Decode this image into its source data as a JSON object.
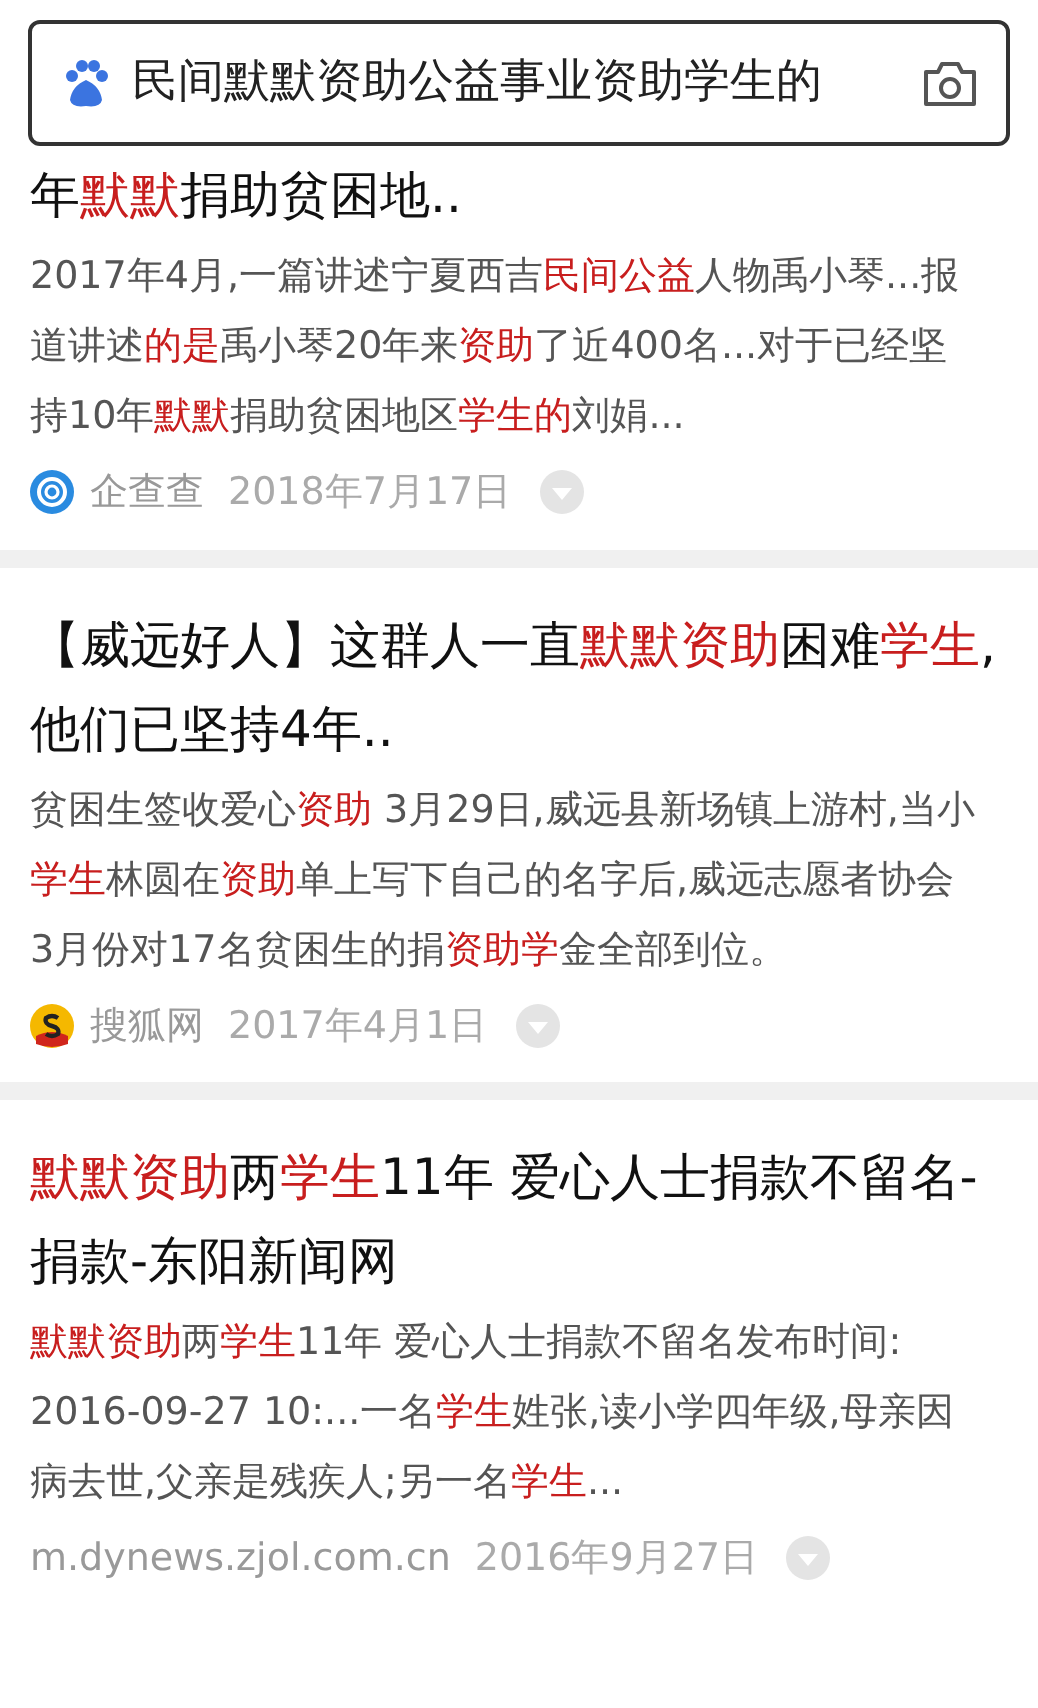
{
  "search": {
    "value": "民间默默资助公益事业资助学生的"
  },
  "results": [
    {
      "title": "年**默默**捐助贫困地..",
      "snippet": "2017年4月,一篇讲述宁夏西吉**民间公益**人物禹小琴...报道讲述**的是**禹小琴20年来**资助**了近400名...对于已经坚持10年**默默**捐助贫困地区**学生的**刘娟...",
      "source": "企查查",
      "kind": "qcc",
      "date": "2018年7月17日"
    },
    {
      "title": "【威远好人】这群人一直**默默资助**困难**学生**,他们已坚持4年..",
      "snippet": "贫困生签收爱心**资助** 3月29日,威远县新场镇上游村,当小**学生**林圆在**资助**单上写下自己的名字后,威远志愿者协会3月份对17名贫困生的捐**资助学**金全部到位。",
      "source": "搜狐网",
      "kind": "sohu",
      "date": "2017年4月1日"
    },
    {
      "title": "**默默资助**两**学生**11年 爱心人士捐款不留名-捐款-东阳新闻网",
      "snippet": "**默默资助**两**学生**11年 爱心人士捐款不留名发布时间: 2016-09-27 10:...一名**学生**姓张,读小学四年级,母亲因病去世,父亲是残疾人;另一名**学生**...",
      "source": "m.dynews.zjol.com.cn",
      "kind": "plain",
      "date": "2016年9月27日"
    }
  ]
}
